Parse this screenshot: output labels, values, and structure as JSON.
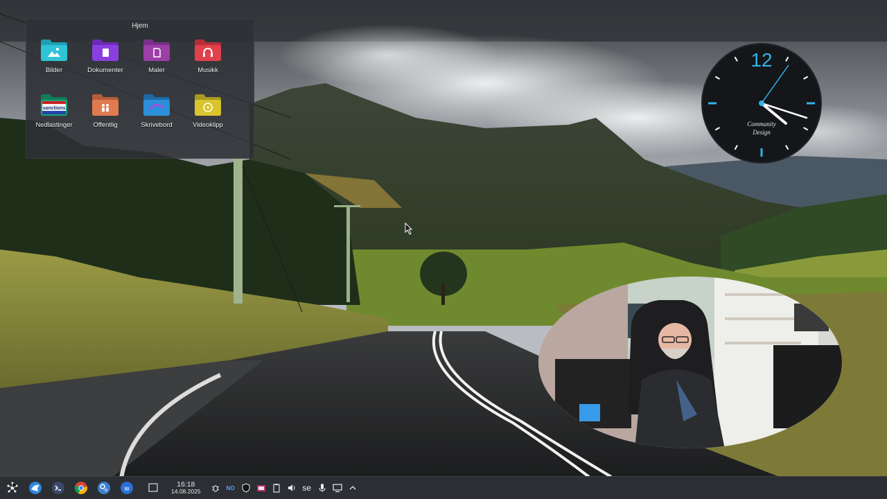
{
  "folder_view": {
    "title": "Hjem",
    "items": [
      {
        "label": "Bilder",
        "color": "#2fc3d6",
        "icon": "image-icon"
      },
      {
        "label": "Dokumenter",
        "color": "#8b3fe0",
        "icon": "document-icon"
      },
      {
        "label": "Maler",
        "color": "#9c3fa8",
        "icon": "template-icon"
      },
      {
        "label": "Musikk",
        "color": "#e0414c",
        "icon": "music-icon"
      },
      {
        "label": "Nedlastinger",
        "color": "#19a77a",
        "icon": "download-icon",
        "badge": "sanctions"
      },
      {
        "label": "Offentlig",
        "color": "#e07a4f",
        "icon": "people-icon"
      },
      {
        "label": "Skrivebord",
        "color": "#2d8fd9",
        "icon": "desktop-icon"
      },
      {
        "label": "Videoklipp",
        "color": "#d8c52e",
        "icon": "video-icon"
      }
    ]
  },
  "analog_clock": {
    "numeral": "12",
    "brand_line1": "Community",
    "brand_line2": "Design",
    "time": "16:18"
  },
  "taskbar": {
    "apps": [
      {
        "name": "app-launcher-button",
        "icon": "kde-launcher-icon"
      },
      {
        "name": "browser-button",
        "icon": "globe-icon"
      },
      {
        "name": "terminal-button",
        "icon": "terminal-icon"
      },
      {
        "name": "chrome-button",
        "icon": "chrome-icon"
      },
      {
        "name": "settings-button",
        "icon": "settings-icon"
      },
      {
        "name": "writer-button",
        "icon": "writer-icon"
      }
    ],
    "show_desktop": "show-desktop-icon",
    "time": "16:18",
    "date": "14.08.2025",
    "tray": {
      "lang_indicator": "NO",
      "keyboard_layout": "se"
    }
  }
}
